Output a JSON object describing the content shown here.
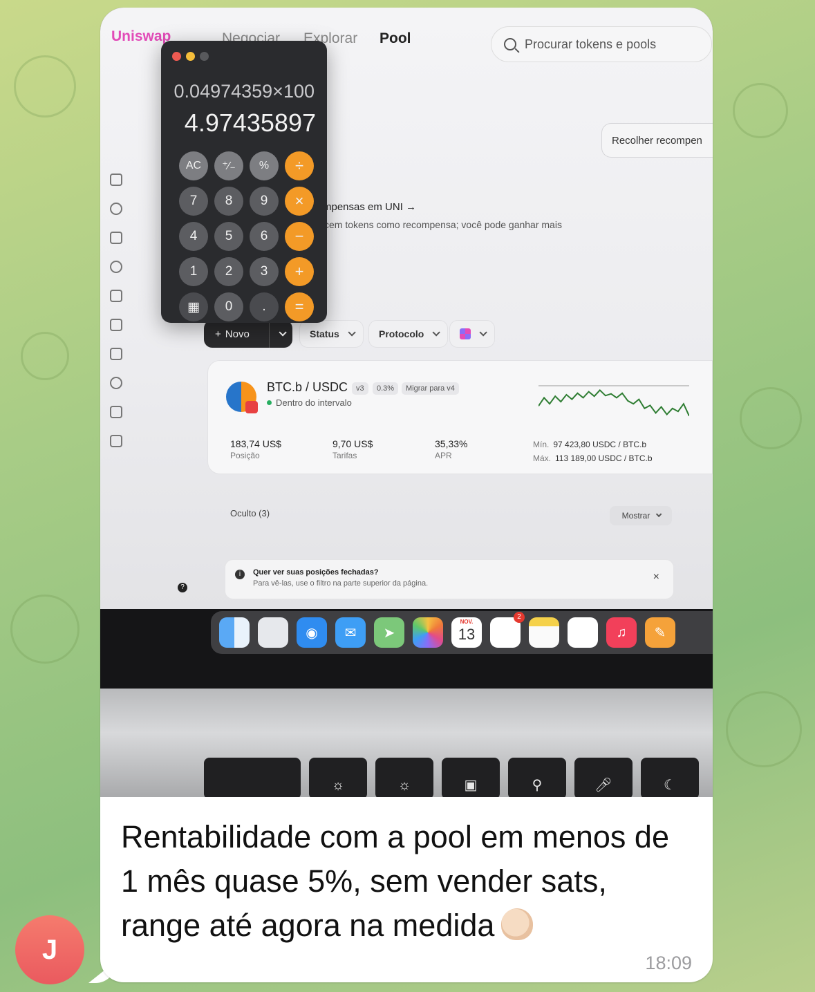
{
  "browser": {
    "brand": "Uniswap",
    "nav": [
      "Negociar",
      "Explorar",
      "Pool"
    ],
    "search_placeholder": "Procurar tokens e pools",
    "rewards_button": "Recolher recompen",
    "rewards_title": "mpensas em UNI →",
    "rewards_desc": "cem tokens como recompensa; você pode ganhar mais"
  },
  "filters": {
    "new": "Novo",
    "status": "Status",
    "protocol": "Protocolo"
  },
  "position": {
    "pair": "BTC.b / USDC",
    "version": "v3",
    "fee": "0.3%",
    "migrate": "Migrar para v4",
    "status": "Dentro do intervalo",
    "stats": [
      {
        "value": "183,74 US$",
        "label": "Posição"
      },
      {
        "value": "9,70 US$",
        "label": "Tarifas"
      },
      {
        "value": "35,33%",
        "label": "APR"
      }
    ],
    "min_label": "Mín.",
    "min_value": "97 423,80 USDC / BTC.b",
    "max_label": "Máx.",
    "max_value": "113 189,00 USDC / BTC.b",
    "price_chart": [
      0.62,
      0.35,
      0.55,
      0.3,
      0.48,
      0.25,
      0.4,
      0.2,
      0.35,
      0.15,
      0.3,
      0.1,
      0.28,
      0.22,
      0.35,
      0.2,
      0.45,
      0.55,
      0.4,
      0.7,
      0.6,
      0.85,
      0.65,
      0.9,
      0.7,
      0.8,
      0.55,
      0.95
    ]
  },
  "hidden": {
    "label": "Oculto (3)",
    "show": "Mostrar"
  },
  "banner": {
    "title": "Quer ver suas posições fechadas?",
    "desc": "Para vê-las, use o filtro na parte superior da página.",
    "close": "×"
  },
  "dock": {
    "calendar_month": "NOV.",
    "calendar_day": "13",
    "reminders_badge": "2"
  },
  "calculator": {
    "expression": "0.04974359×100",
    "result": "4.97435897",
    "keys": [
      [
        "AC",
        "⁺∕₋",
        "%",
        "÷"
      ],
      [
        "7",
        "8",
        "9",
        "×"
      ],
      [
        "4",
        "5",
        "6",
        "−"
      ],
      [
        "1",
        "2",
        "3",
        "+"
      ],
      [
        "▦",
        "0",
        ".",
        "="
      ]
    ]
  },
  "message": {
    "text": "Rentabilidade com a pool em menos de 1 mês quase 5%, sem vender sats, range até agora na medida",
    "time": "18:09",
    "avatar_initial": "J"
  },
  "colors": {
    "accent": "#e24bb8",
    "calc_operator": "#f39a27",
    "avatar": "#ea5a5f"
  }
}
